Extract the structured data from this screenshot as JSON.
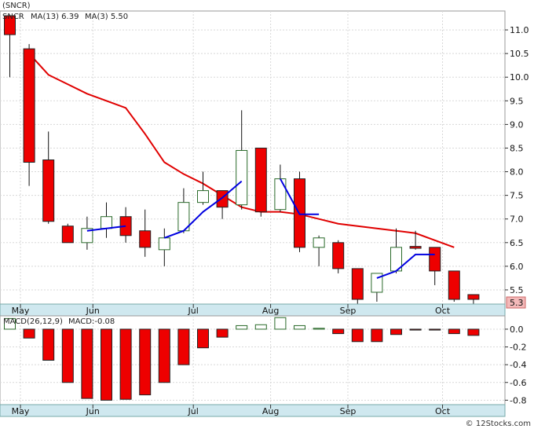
{
  "chart_data": [
    {
      "type": "candlestick",
      "symbol_label": "(SNCR)",
      "ticker_label": "SNCR",
      "legend": [
        {
          "text": "MA(13)",
          "value_text": "6.39",
          "color": "#e00000"
        },
        {
          "text": "MA(3)",
          "value_text": "5.50",
          "color": "#0000e0"
        }
      ],
      "ylim": [
        5.2,
        11.4
      ],
      "y_ticks": [
        5.5,
        6.0,
        6.5,
        7.0,
        7.5,
        8.0,
        8.5,
        9.0,
        9.5,
        10.0,
        10.5,
        11.0
      ],
      "y_tick_labels": [
        "5.5",
        "6.0",
        "6.5",
        "7.0",
        "7.5",
        "8.0",
        "8.5",
        "9.0",
        "9.5",
        "10.0",
        "10.5",
        "11.0"
      ],
      "last_price_label": "5.3",
      "x_month_labels": [
        "May",
        "Jun",
        "Jul",
        "Aug",
        "Sep",
        "Oct"
      ],
      "candles": [
        {
          "open": 10.9,
          "high": 11.2,
          "low": 10.0,
          "close": 11.3,
          "color": "red"
        },
        {
          "open": 10.6,
          "high": 10.7,
          "low": 7.7,
          "close": 8.2,
          "color": "red"
        },
        {
          "open": 8.25,
          "high": 8.85,
          "low": 6.9,
          "close": 6.95,
          "color": "red"
        },
        {
          "open": 6.85,
          "high": 6.9,
          "low": 6.5,
          "close": 6.5,
          "color": "red"
        },
        {
          "open": 6.5,
          "high": 7.05,
          "low": 6.35,
          "close": 6.8,
          "color": "white"
        },
        {
          "open": 6.8,
          "high": 7.35,
          "low": 6.6,
          "close": 7.05,
          "color": "white"
        },
        {
          "open": 7.05,
          "high": 7.25,
          "low": 6.5,
          "close": 6.65,
          "color": "red"
        },
        {
          "open": 6.75,
          "high": 7.2,
          "low": 6.2,
          "close": 6.4,
          "color": "red"
        },
        {
          "open": 6.35,
          "high": 6.8,
          "low": 6.0,
          "close": 6.6,
          "color": "white"
        },
        {
          "open": 6.75,
          "high": 7.65,
          "low": 6.7,
          "close": 7.35,
          "color": "white"
        },
        {
          "open": 7.35,
          "high": 8.0,
          "low": 7.3,
          "close": 7.6,
          "color": "white"
        },
        {
          "open": 7.6,
          "high": 7.6,
          "low": 7.0,
          "close": 7.25,
          "color": "red"
        },
        {
          "open": 7.3,
          "high": 9.3,
          "low": 7.2,
          "close": 8.45,
          "color": "white"
        },
        {
          "open": 8.5,
          "high": 8.5,
          "low": 7.05,
          "close": 7.15,
          "color": "red"
        },
        {
          "open": 7.2,
          "high": 8.15,
          "low": 7.15,
          "close": 7.85,
          "color": "white"
        },
        {
          "open": 7.85,
          "high": 8.0,
          "low": 6.3,
          "close": 6.4,
          "color": "red"
        },
        {
          "open": 6.4,
          "high": 6.65,
          "low": 6.0,
          "close": 6.6,
          "color": "white"
        },
        {
          "open": 6.5,
          "high": 6.55,
          "low": 5.85,
          "close": 5.95,
          "color": "red"
        },
        {
          "open": 5.95,
          "high": 5.95,
          "low": 5.2,
          "close": 5.3,
          "color": "red"
        },
        {
          "open": 5.45,
          "high": 5.85,
          "low": 5.25,
          "close": 5.85,
          "color": "white"
        },
        {
          "open": 5.9,
          "high": 6.8,
          "low": 5.85,
          "close": 6.4,
          "color": "white"
        },
        {
          "open": 6.42,
          "high": 6.75,
          "low": 6.35,
          "close": 6.38,
          "color": "red"
        },
        {
          "open": 6.4,
          "high": 6.4,
          "low": 5.6,
          "close": 5.9,
          "color": "red"
        },
        {
          "open": 5.9,
          "high": 5.9,
          "low": 5.25,
          "close": 5.3,
          "color": "red"
        },
        {
          "open": 5.4,
          "high": 5.4,
          "low": 5.2,
          "close": 5.3,
          "color": "red"
        }
      ],
      "ma13": [
        null,
        10.5,
        10.05,
        9.85,
        9.65,
        9.5,
        9.35,
        8.8,
        8.2,
        7.95,
        7.75,
        7.5,
        7.25,
        7.15,
        7.15,
        7.1,
        7.0,
        6.9,
        6.85,
        6.8,
        6.75,
        6.7,
        6.55,
        6.4,
        null
      ],
      "ma3": [
        null,
        null,
        null,
        null,
        6.75,
        6.8,
        6.85,
        null,
        6.6,
        6.75,
        7.15,
        7.45,
        7.8,
        null,
        7.85,
        7.1,
        7.1,
        null,
        null,
        5.75,
        5.9,
        6.25,
        6.25,
        null,
        null
      ]
    },
    {
      "type": "bar",
      "title": "MACD(26,12,9)",
      "legend": [
        {
          "text": "MACD:-0.08",
          "color": "#0000e0"
        }
      ],
      "ylim": [
        -0.85,
        0.15
      ],
      "y_ticks": [
        0.0,
        -0.2,
        -0.4,
        -0.6,
        -0.8
      ],
      "y_tick_labels": [
        "0.0",
        "-0.2",
        "-0.4",
        "-0.6",
        "-0.8"
      ],
      "x_month_labels": [
        "May",
        "Jun",
        "Jul",
        "Aug",
        "Sep",
        "Oct"
      ],
      "values": [
        0.12,
        -0.1,
        -0.35,
        -0.6,
        -0.78,
        -0.8,
        -0.79,
        -0.74,
        -0.6,
        -0.4,
        -0.21,
        -0.09,
        0.04,
        0.05,
        0.13,
        0.04,
        0.01,
        -0.05,
        -0.14,
        -0.14,
        -0.06,
        -0.01,
        -0.01,
        -0.05,
        -0.07
      ]
    }
  ],
  "watermark": "© 12Stocks.com"
}
